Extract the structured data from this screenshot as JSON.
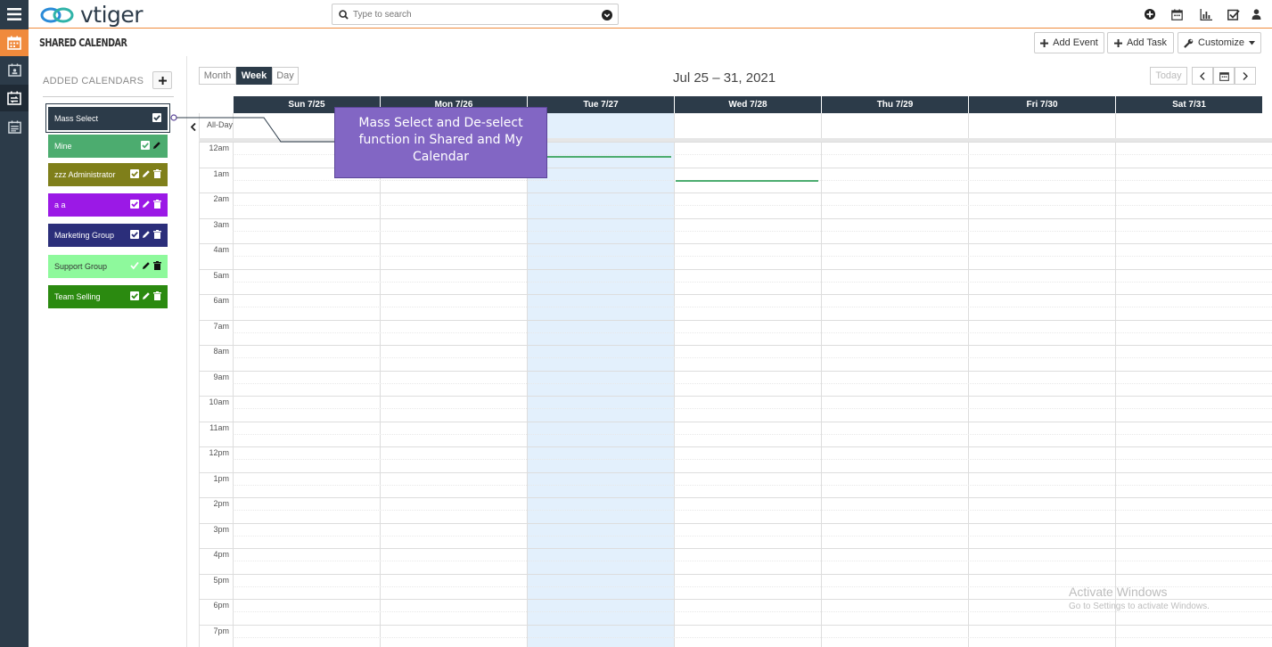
{
  "app": {
    "name": "vtiger"
  },
  "search": {
    "placeholder": "Type to search"
  },
  "module": {
    "title": "SHARED CALENDAR"
  },
  "header_buttons": {
    "add_event": "Add Event",
    "add_task": "Add Task",
    "customize": "Customize"
  },
  "sidebar": {
    "added_calendars": "ADDED CALENDARS",
    "items": [
      {
        "label": "Mass Select",
        "color": "#2c3b49"
      },
      {
        "label": "Mine",
        "color": "#4cac6f"
      },
      {
        "label": "zzz Administrator",
        "color": "#7f7f1a"
      },
      {
        "label": "a a",
        "color": "#9b19e6"
      },
      {
        "label": "Marketing Group",
        "color": "#2b2e7a"
      },
      {
        "label": "Support Group",
        "color": "#8ef99c"
      },
      {
        "label": "Team Selling",
        "color": "#2b8a10"
      }
    ]
  },
  "views": {
    "month": "Month",
    "week": "Week",
    "day": "Day",
    "active": "Week"
  },
  "range": "Jul 25 – 31, 2021",
  "nav": {
    "today": "Today"
  },
  "days": [
    "Sun 7/25",
    "Mon 7/26",
    "Tue 7/27",
    "Wed 7/28",
    "Thu 7/29",
    "Fri 7/30",
    "Sat 7/31"
  ],
  "all_day": "All-Day",
  "hours": [
    "12am",
    "1am",
    "2am",
    "3am",
    "4am",
    "5am",
    "6am",
    "7am",
    "8am",
    "9am",
    "10am",
    "11am",
    "12pm",
    "1pm",
    "2pm",
    "3pm",
    "4pm",
    "5pm",
    "6pm",
    "7pm"
  ],
  "tooltip": {
    "text": "Mass Select and De-select function in Shared and My Calendar"
  },
  "watermark": {
    "line1": "Activate Windows",
    "line2": "Go to Settings to activate Windows."
  },
  "colors": {
    "accent": "#f08a3c",
    "dark": "#2c3b49",
    "today_bg": "#e3f0fc",
    "event": "#4cac6f",
    "tooltip": "#8266c4"
  }
}
